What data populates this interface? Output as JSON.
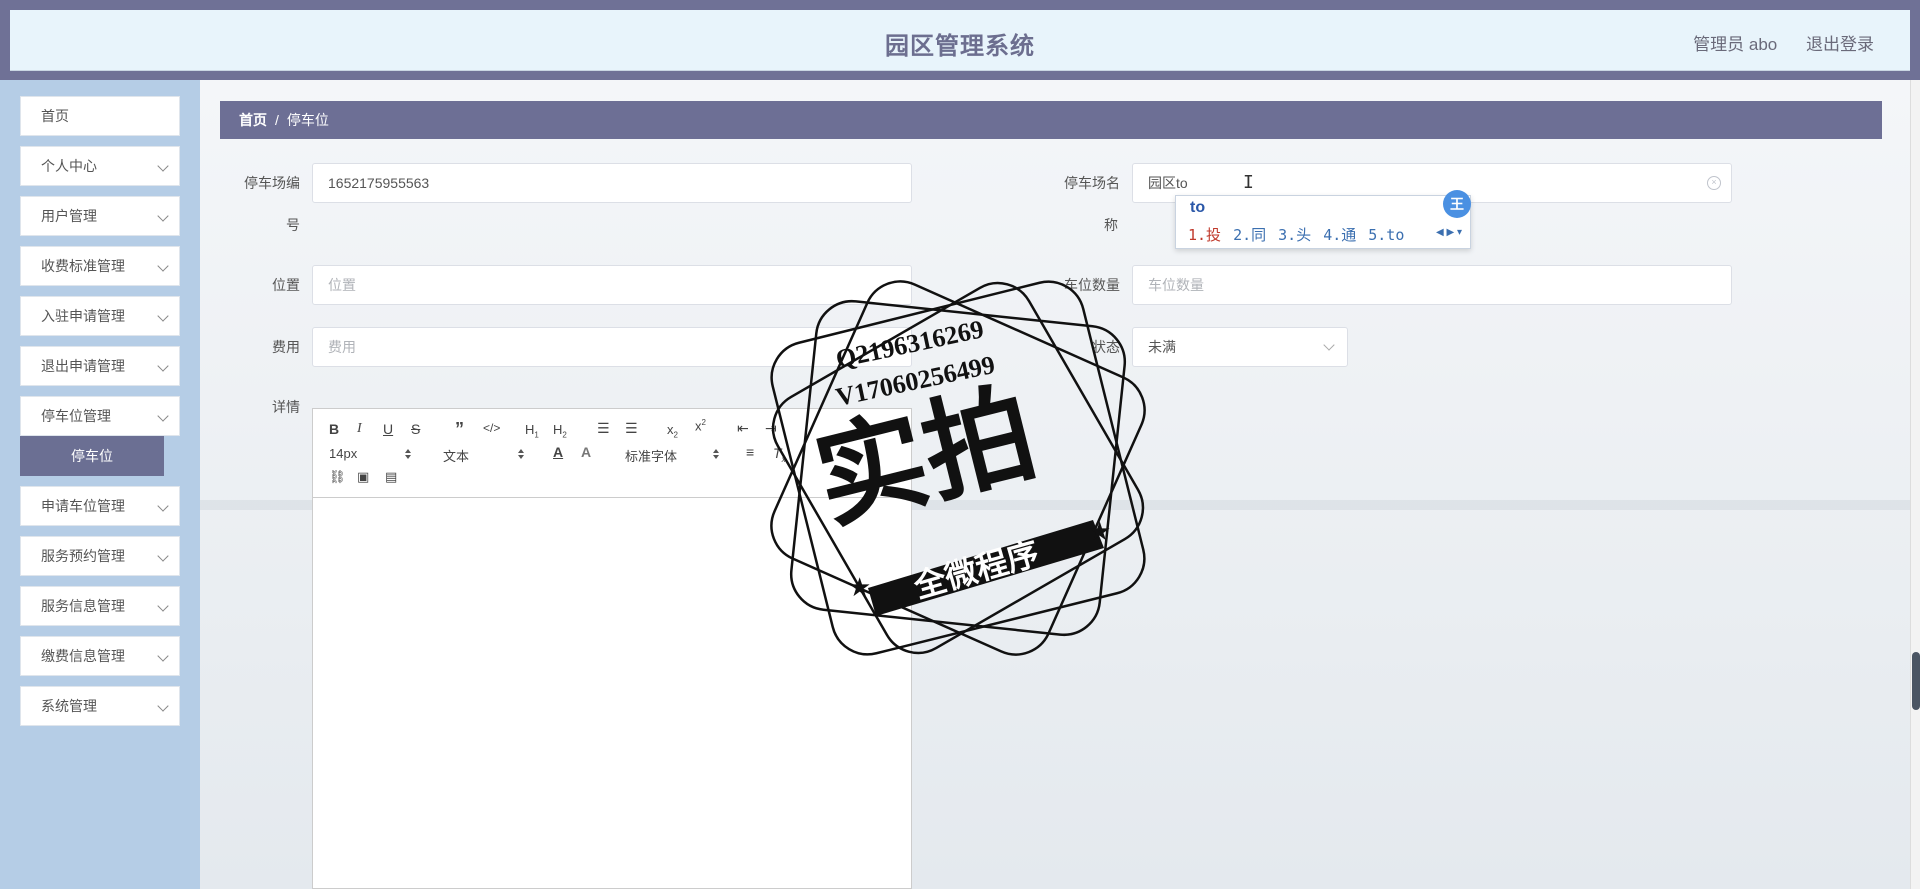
{
  "header": {
    "title": "园区管理系统",
    "admin_label": "管理员 abo",
    "logout_label": "退出登录"
  },
  "sidebar": {
    "items": [
      {
        "label": "首页",
        "has_arrow": false
      },
      {
        "label": "个人中心",
        "has_arrow": true
      },
      {
        "label": "用户管理",
        "has_arrow": true
      },
      {
        "label": "收费标准管理",
        "has_arrow": true
      },
      {
        "label": "入驻申请管理",
        "has_arrow": true
      },
      {
        "label": "退出申请管理",
        "has_arrow": true
      },
      {
        "label": "停车位管理",
        "has_arrow": true
      },
      {
        "label": "申请车位管理",
        "has_arrow": true
      },
      {
        "label": "服务预约管理",
        "has_arrow": true
      },
      {
        "label": "服务信息管理",
        "has_arrow": true
      },
      {
        "label": "缴费信息管理",
        "has_arrow": true
      },
      {
        "label": "系统管理",
        "has_arrow": true
      }
    ],
    "active_sub": "停车位"
  },
  "breadcrumb": {
    "home": "首页",
    "separator": "/",
    "current": "停车位"
  },
  "form": {
    "code_label_1": "停车场编",
    "code_label_2": "号",
    "code_value": "1652175955563",
    "name_label_1": "停车场名",
    "name_label_2": "称",
    "name_value": "园区to",
    "location_label": "位置",
    "location_placeholder": "位置",
    "spaces_label": "车位数量",
    "spaces_placeholder": "车位数量",
    "fee_label": "费用",
    "fee_placeholder": "费用",
    "status_label": "状态",
    "status_value": "未满",
    "details_label": "详情"
  },
  "editor": {
    "font_size": "14px",
    "text_style": "文本",
    "font_family": "标准字体"
  },
  "ime": {
    "composition": "to",
    "candidates": [
      "1.投",
      "2.同",
      "3.头",
      "4.通",
      "5.to"
    ],
    "badge": "王"
  },
  "watermark": {
    "line1": "Q2196316269",
    "line2": "V17060256499",
    "big": "实拍",
    "banner": "全微程序"
  }
}
